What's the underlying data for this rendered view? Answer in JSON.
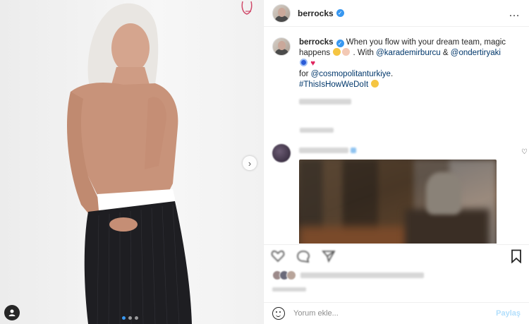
{
  "post": {
    "username": "berrocks",
    "more_icon": "…",
    "caption": {
      "username": "berrocks",
      "text_1": "When you flow with your dream team, magic happens",
      "text_2": ". With",
      "mention_1": "@karademirburcu",
      "amp": "&",
      "mention_2": "@ondertiryaki",
      "text_3": "for",
      "mention_3": "@cosmopolitanturkiye",
      "dot": ".",
      "hashtag": "#ThisIsHowWeDoIt"
    },
    "add_comment": {
      "placeholder": "Yorum ekle...",
      "post_label": "Paylaş"
    }
  },
  "colors": {
    "verified": "#3897f0",
    "link": "#00376b",
    "post_disabled": "#b2dffc"
  },
  "icons": [
    "verified-badge-icon",
    "more-options-icon",
    "next-arrow-icon",
    "heart-icon",
    "comment-icon",
    "share-icon",
    "bookmark-icon",
    "emoji-icon",
    "tagged-user-icon"
  ]
}
